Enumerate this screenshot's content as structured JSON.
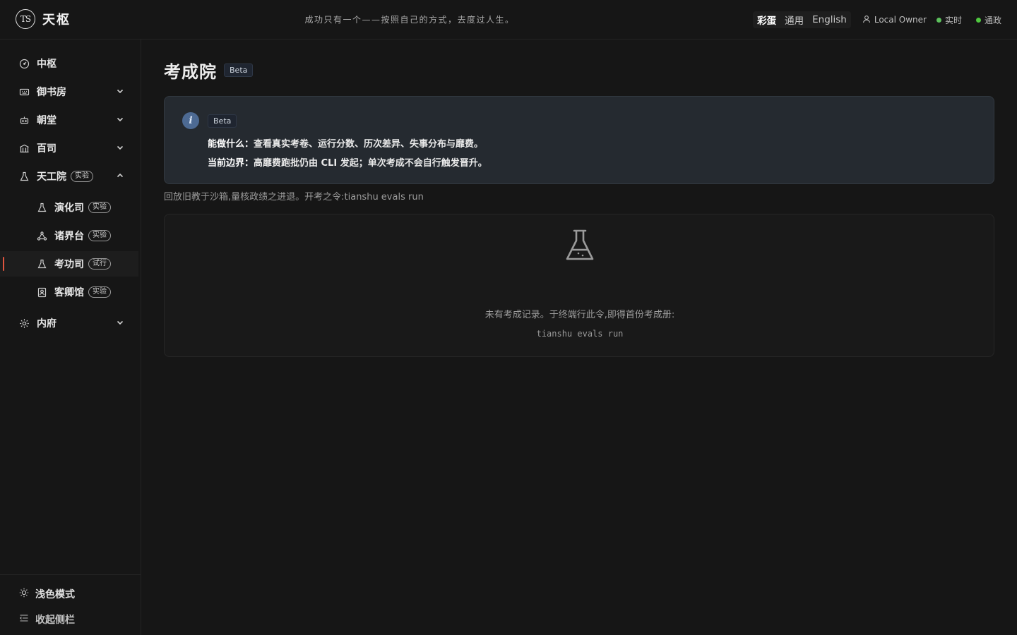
{
  "app": {
    "logo_text": "TS",
    "name": "天枢"
  },
  "header": {
    "motto": "成功只有一个——按照自己的方式，去度过人生。",
    "lang_options": [
      "彩蛋",
      "通用",
      "English"
    ],
    "user": "Local Owner",
    "status_realtime": "实时",
    "status_governance": "通政",
    "colors": {
      "status_dot": "#5cc05c"
    }
  },
  "sidebar": {
    "items": [
      {
        "label": "中枢"
      },
      {
        "label": "御书房"
      },
      {
        "label": "朝堂"
      },
      {
        "label": "百司"
      },
      {
        "label": "天工院",
        "badge": "实验"
      },
      {
        "label": "演化司",
        "badge": "实验"
      },
      {
        "label": "诸界台",
        "badge": "实验"
      },
      {
        "label": "考功司",
        "badge": "试行"
      },
      {
        "label": "客卿馆",
        "badge": "实验"
      },
      {
        "label": "内府"
      }
    ],
    "theme_toggle": "浅色模式",
    "collapse": "收起侧栏"
  },
  "main": {
    "title": "考成院",
    "title_badge": "Beta",
    "info": {
      "badge": "Beta",
      "can_label": "能做什么：",
      "can_text": "查看真实考卷、运行分数、历次差异、失事分布与靡费。",
      "limit_label": "当前边界：",
      "limit_text": "高靡费跑批仍由 CLI 发起；单次考成不会自行触发晋升。"
    },
    "hint": "回放旧教于沙箱,量核政绩之进退。开考之令:tianshu evals run",
    "empty": {
      "message": "未有考成记录。于终端行此令,即得首份考成册:",
      "command": "tianshu evals run"
    }
  }
}
